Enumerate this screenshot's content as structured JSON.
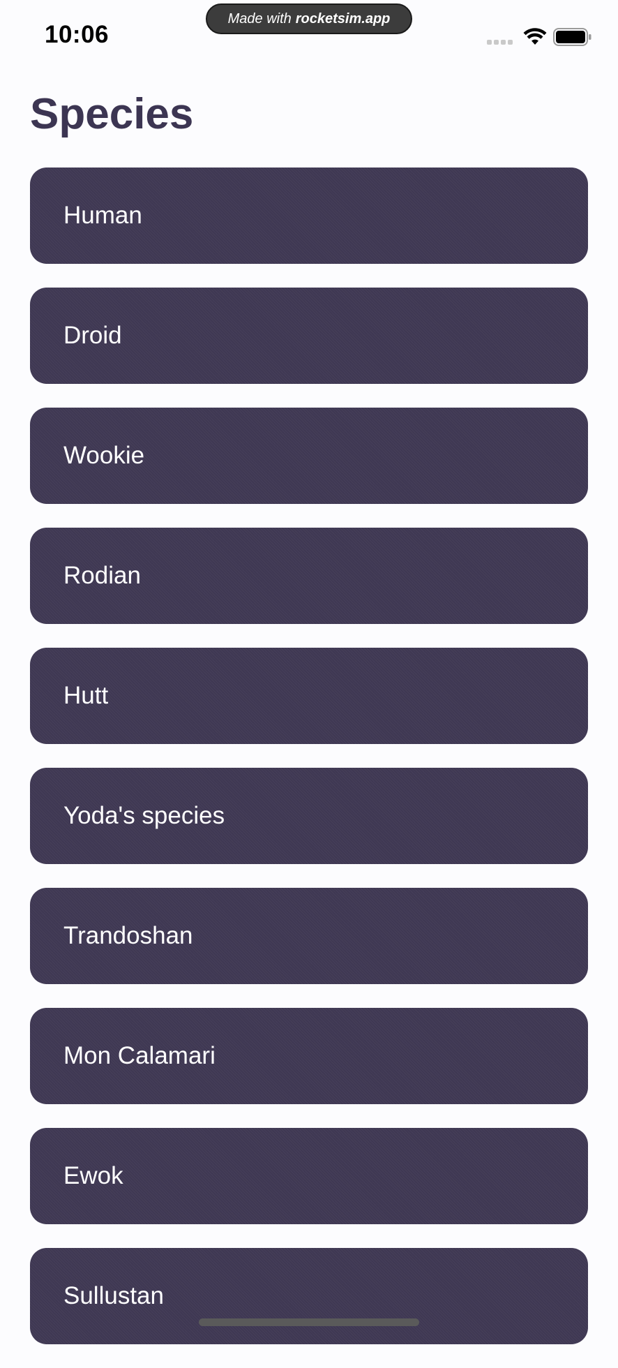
{
  "status_bar": {
    "time": "10:06",
    "banner_prefix": "Made with",
    "banner_brand": "rocketsim.app",
    "icons": [
      "signal-icon",
      "wifi-icon",
      "battery-icon"
    ]
  },
  "page": {
    "title": "Species"
  },
  "species": [
    {
      "label": "Human"
    },
    {
      "label": "Droid"
    },
    {
      "label": "Wookie"
    },
    {
      "label": "Rodian"
    },
    {
      "label": "Hutt"
    },
    {
      "label": "Yoda's species"
    },
    {
      "label": "Trandoshan"
    },
    {
      "label": "Mon Calamari"
    },
    {
      "label": "Ewok"
    },
    {
      "label": "Sullustan"
    }
  ],
  "colors": {
    "background": "#FCFCFE",
    "title": "#3C3552",
    "row": "#3F3853",
    "row_text": "#FFFFFF"
  }
}
